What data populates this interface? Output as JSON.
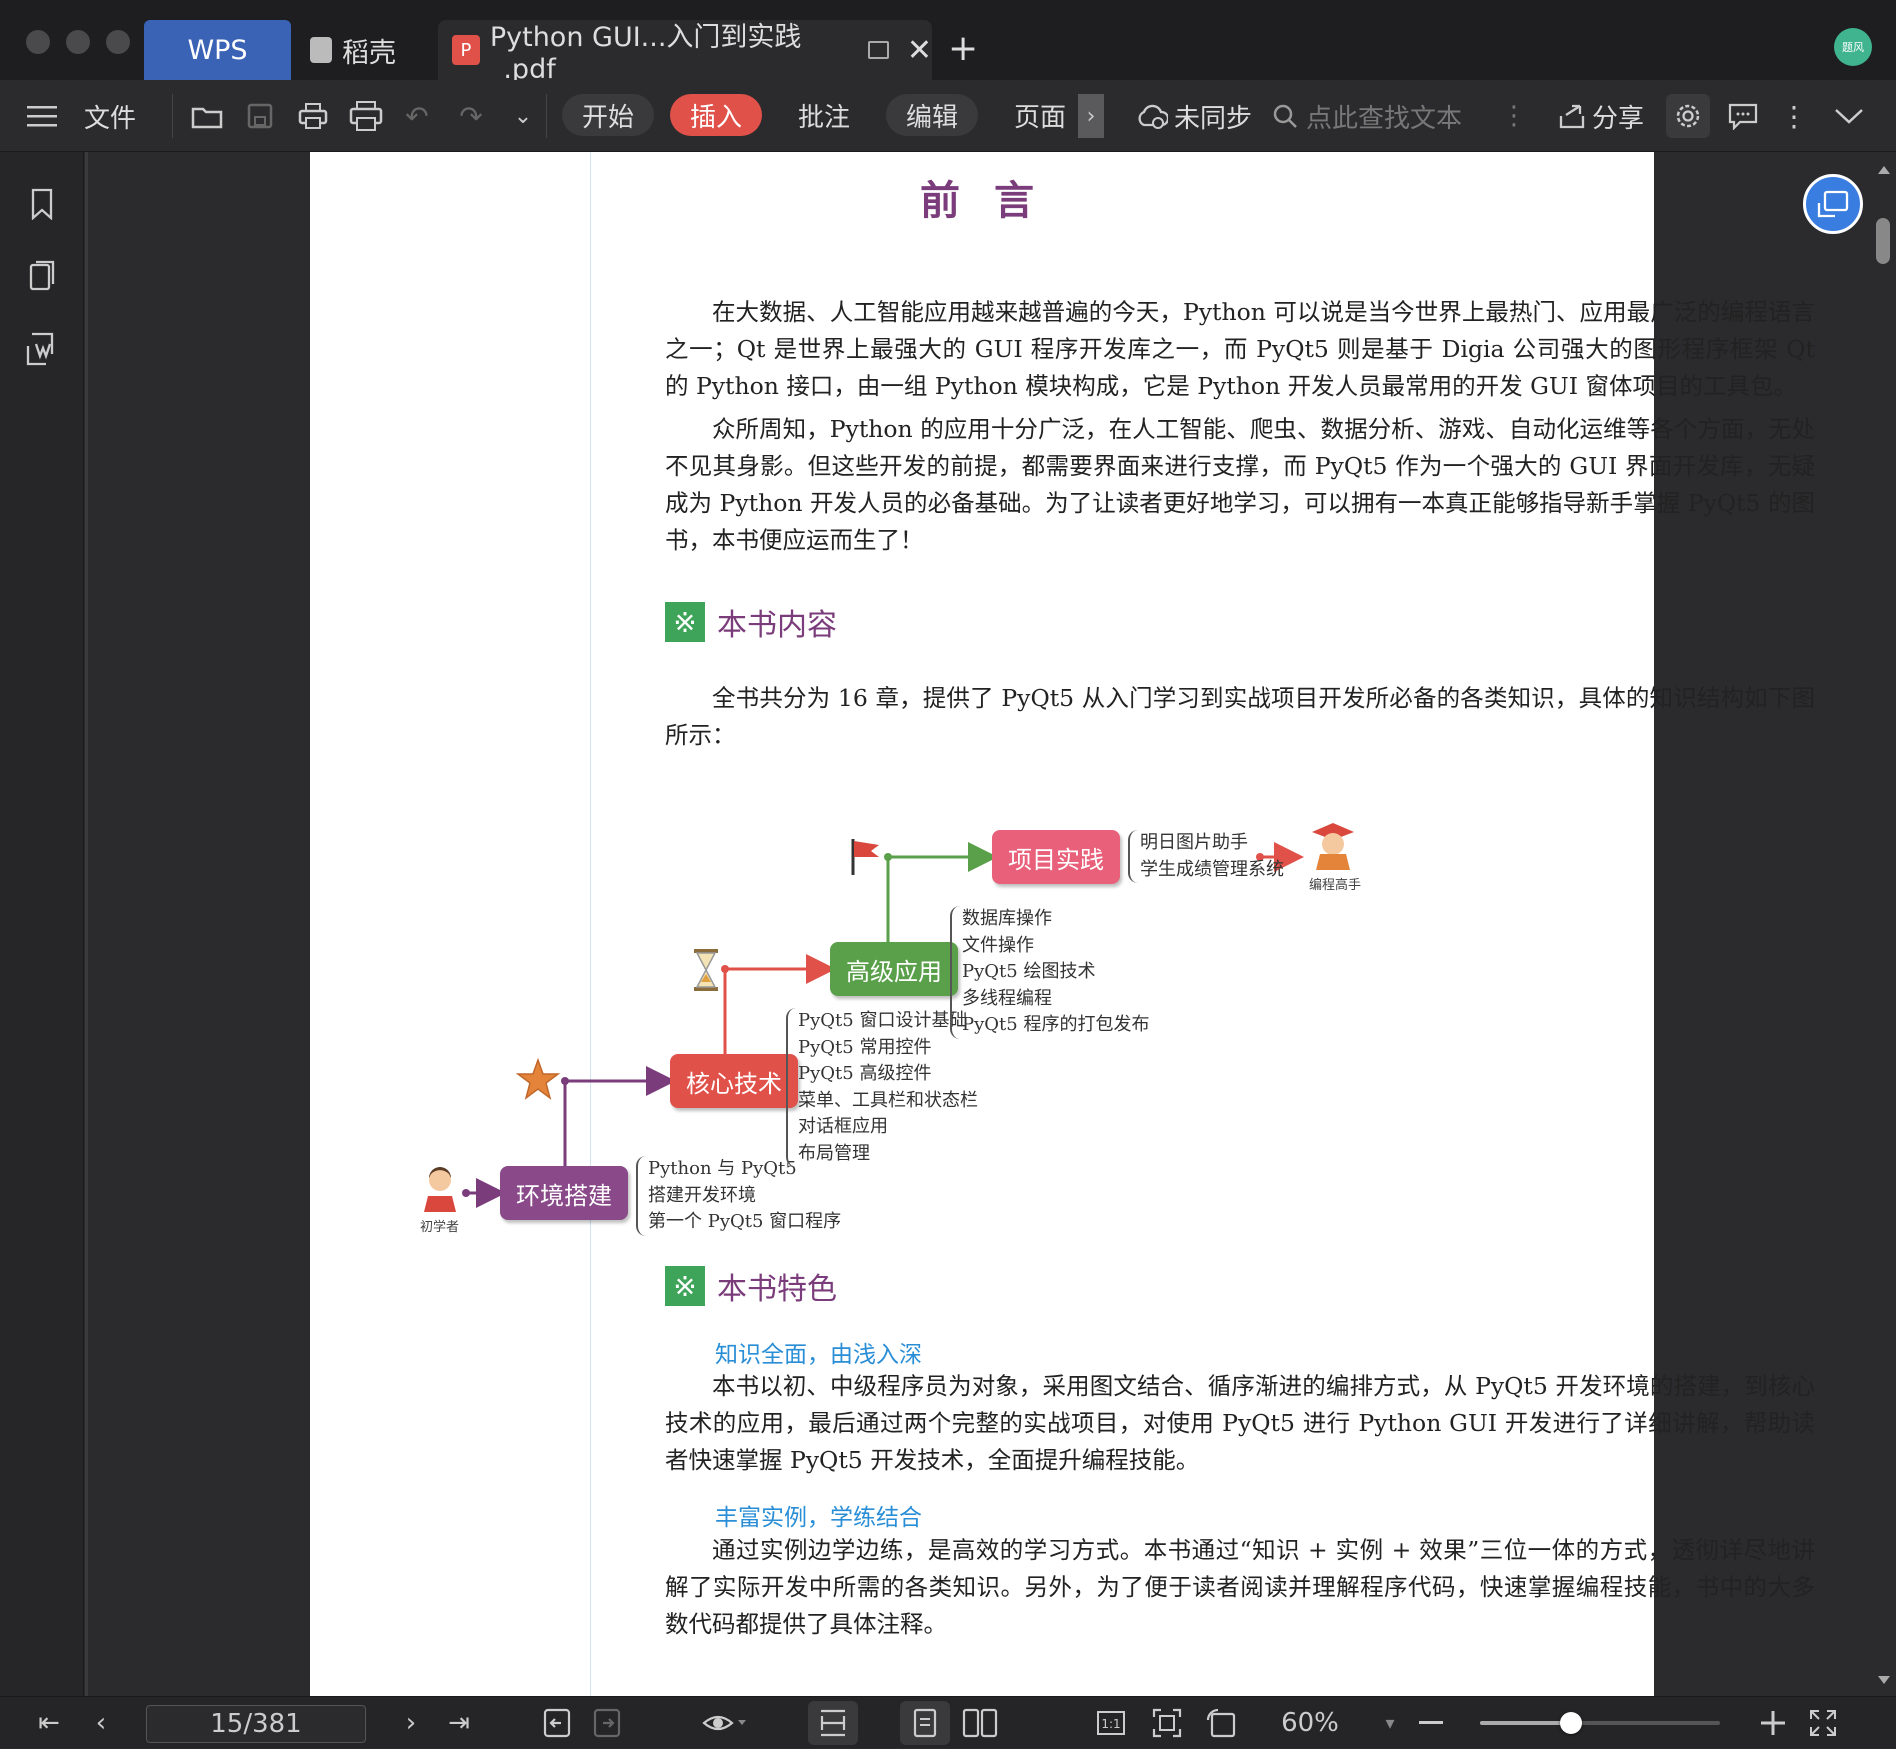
{
  "titlebar": {
    "tabs": [
      {
        "label": "WPS"
      },
      {
        "label": "稻壳"
      },
      {
        "label": "Python GUI...入门到实践_.pdf"
      }
    ],
    "avatar_text": "题风"
  },
  "toolbar": {
    "menu_label": "文件",
    "tabs": [
      "开始",
      "插入",
      "批注",
      "编辑",
      "页面"
    ],
    "active_tab": "插入",
    "sync_label": "未同步",
    "search_placeholder": "点此查找文本",
    "share_label": "分享"
  },
  "document": {
    "title": "前 言",
    "paragraphs": [
      "在大数据、人工智能应用越来越普遍的今天，Python 可以说是当今世界上最热门、应用最广泛的编程语言之一；Qt 是世界上最强大的 GUI 程序开发库之一，而 PyQt5 则是基于 Digia 公司强大的图形程序框架 Qt 的 Python 接口，由一组 Python 模块构成，它是 Python 开发人员最常用的开发 GUI 窗体项目的工具包。",
      "众所周知，Python 的应用十分广泛，在人工智能、爬虫、数据分析、游戏、自动化运维等各个方面，无处不见其身影。但这些开发的前提，都需要界面来进行支撑，而 PyQt5 作为一个强大的 GUI 界面开发库，无疑成为 Python 开发人员的必备基础。为了让读者更好地学习，可以拥有一本真正能够指导新手掌握 PyQt5 的图书，本书便应运而生了！"
    ],
    "section1": {
      "title": "本书内容",
      "intro": "全书共分为 16 章，提供了 PyQt5 从入门学习到实战项目开发所必备的各类知识，具体的知识结构如下图所示："
    },
    "diagram": {
      "beginner_caption": "初学者",
      "expert_caption": "编程高手",
      "nodes": [
        {
          "label": "环境搭建",
          "items": [
            "Python 与 PyQt5",
            "搭建开发环境",
            "第一个 PyQt5 窗口程序"
          ]
        },
        {
          "label": "核心技术",
          "items": [
            "PyQt5 窗口设计基础",
            "PyQt5 常用控件",
            "PyQt5 高级控件",
            "菜单、工具栏和状态栏",
            "对话框应用",
            "布局管理"
          ]
        },
        {
          "label": "高级应用",
          "items": [
            "数据库操作",
            "文件操作",
            "PyQt5 绘图技术",
            "多线程编程",
            "PyQt5 程序的打包发布"
          ]
        },
        {
          "label": "项目实践",
          "items": [
            "明日图片助手",
            "学生成绩管理系统"
          ]
        }
      ]
    },
    "section2": {
      "title": "本书特色",
      "features": [
        {
          "title": "知识全面，由浅入深",
          "text": "本书以初、中级程序员为对象，采用图文结合、循序渐进的编排方式，从 PyQt5 开发环境的搭建，到核心技术的应用，最后通过两个完整的实战项目，对使用 PyQt5 进行 Python GUI 开发进行了详细讲解，帮助读者快速掌握 PyQt5 开发技术，全面提升编程技能。"
        },
        {
          "title": "丰富实例，学练结合",
          "text": "通过实例边学边练，是高效的学习方式。本书通过“知识 + 实例 + 效果”三位一体的方式，透彻详尽地讲解了实际开发中所需的各类知识。另外，为了便于读者阅读并理解程序代码，快速掌握编程技能，书中的大多数代码都提供了具体注释。"
        }
      ]
    }
  },
  "statusbar": {
    "page_indicator": "15/381",
    "zoom": "60%",
    "zoom_fraction": 0.38
  },
  "colors": {
    "accent_red": "#e0514a",
    "wps_blue": "#3a63b6",
    "heading_purple": "#7a3c7a",
    "subhead_blue": "#2a8ed6"
  }
}
